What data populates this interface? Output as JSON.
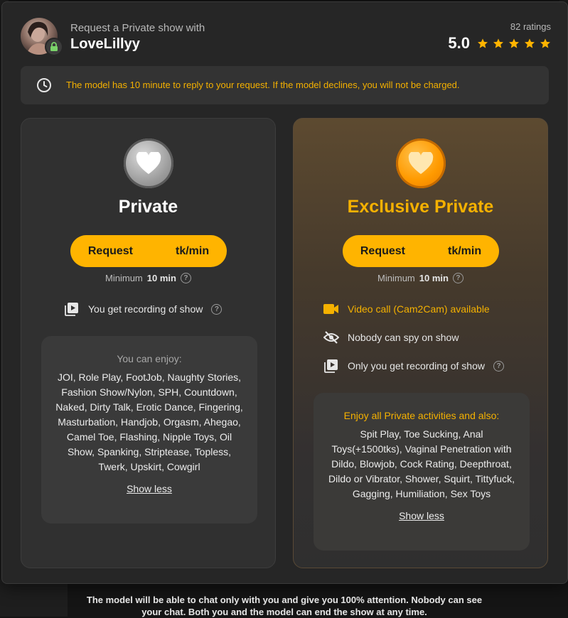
{
  "header": {
    "request_label": "Request a Private show with",
    "model_name": "LoveLillyy",
    "ratings_count": "82 ratings",
    "rating_value": "5.0",
    "stars": 5
  },
  "notice": {
    "text": "The model has 10 minute to reply to your request. If the model declines, you will not be charged."
  },
  "private": {
    "title": "Private",
    "request_label": "Request",
    "rate_label": "tk/min",
    "minimum_prefix": "Minimum",
    "minimum_value": "10 min",
    "feature_recording": "You get recording of show",
    "enjoy_title": "You can enjoy:",
    "enjoy_list": "JOI, Role Play, FootJob, Naughty Stories, Fashion Show/Nylon, SPH, Countdown, Naked, Dirty Talk, Erotic Dance, Fingering, Masturbation, Handjob, Orgasm, Ahegao, Camel Toe, Flashing, Nipple Toys, Oil Show, Spanking, Striptease, Topless, Twerk, Upskirt, Cowgirl",
    "show_less": "Show less"
  },
  "exclusive": {
    "title": "Exclusive Private",
    "request_label": "Request",
    "rate_label": "tk/min",
    "minimum_prefix": "Minimum",
    "minimum_value": "10 min",
    "feature_video": "Video call (Cam2Cam) available",
    "feature_nospy": "Nobody can spy on show",
    "feature_recording": "Only you get recording of show",
    "enjoy_title": "Enjoy all Private activities and also:",
    "enjoy_list": "Spit Play, Toe Sucking, Anal Toys(+1500tks), Vaginal Penetration with Dildo, Blowjob, Cock Rating, Deepthroat, Dildo or Vibrator, Shower, Squirt, Tittyfuck, Gagging, Humiliation, Sex Toys",
    "show_less": "Show less"
  },
  "footer": {
    "text": "The model will be able to chat only with you and give you 100% attention. Nobody can see your chat. Both you and the model can end the show at any time."
  },
  "colors": {
    "accent": "#ffb400",
    "accent_text": "#f5b100",
    "modal_bg": "#262626",
    "card_bg": "#303030"
  },
  "icons": {
    "clock": "clock-icon",
    "lock": "lock-icon",
    "star": "star-icon",
    "heart": "heart-icon",
    "recording": "video-recording-icon",
    "camera": "video-camera-icon",
    "eye_off": "eye-off-icon",
    "help": "help-icon"
  }
}
